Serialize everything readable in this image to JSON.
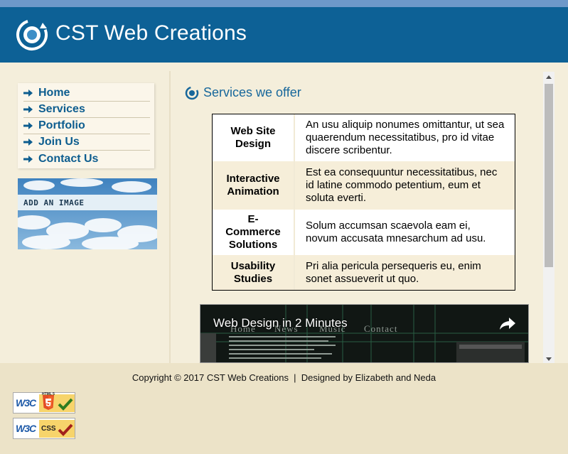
{
  "site": {
    "title": "CST Web Creations"
  },
  "nav": {
    "items": [
      {
        "label": "Home"
      },
      {
        "label": "Services"
      },
      {
        "label": "Portfolio"
      },
      {
        "label": "Join Us"
      },
      {
        "label": "Contact Us"
      }
    ]
  },
  "sidebar": {
    "ad_text": "ADD AN IMAGE"
  },
  "main": {
    "section_title": "Services we offer",
    "services": [
      {
        "name": "Web Site Design",
        "description": "An usu aliquip nonumes omittantur, ut sea quaerendum necessitatibus, pro id vitae discere scribentur."
      },
      {
        "name": "Interactive Animation",
        "description": "Est ea consequuntur necessitatibus, nec id latine commodo petentium, eum et soluta everti."
      },
      {
        "name": "E-Commerce Solutions",
        "description": "Solum accumsan scaevola eam ei, novum accusata mnesarchum ad usu."
      },
      {
        "name": "Usability Studies",
        "description": "Pri alia pericula persequeris eu, enim sonet assueverit ut quo."
      }
    ],
    "video": {
      "title": "Web Design in 2 Minutes",
      "menu_words": [
        "Home",
        "News",
        "Music",
        "Contact"
      ]
    }
  },
  "footer": {
    "copyright": "Copyright © 2017 CST Web Creations  |  Designed by Elizabeth and Neda",
    "badges": [
      {
        "left": "W3C",
        "right": "HTML 5"
      },
      {
        "left": "W3C",
        "right": "CSS"
      }
    ]
  },
  "colors": {
    "header_bg": "#0d6196",
    "top_strip": "#6d98c9",
    "accent_text": "#17679b",
    "body_bg": "#f4eedb",
    "footer_bg": "#ece3c8"
  }
}
